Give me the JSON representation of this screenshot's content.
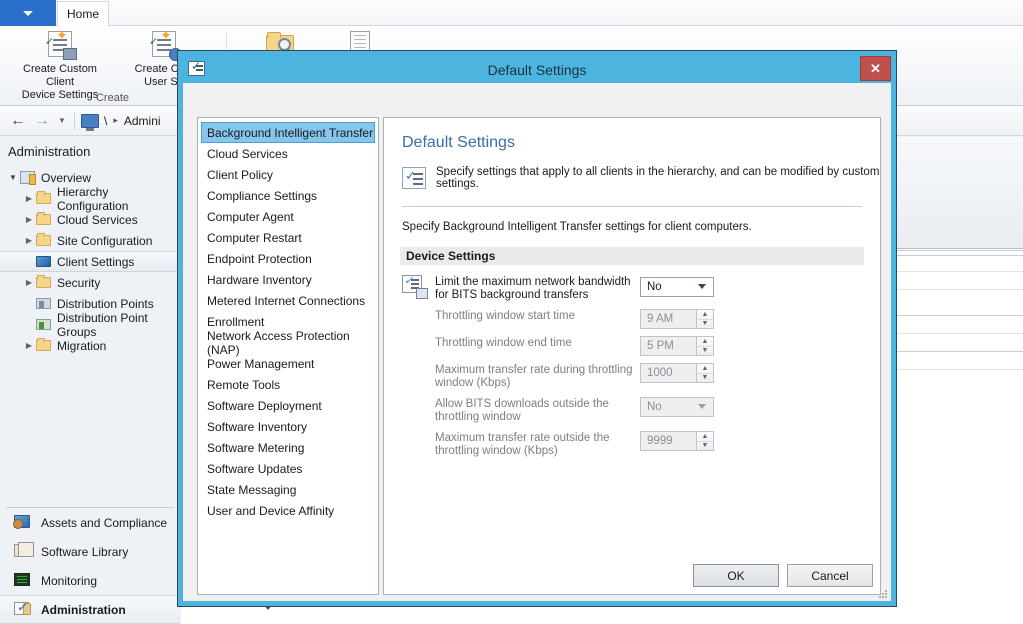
{
  "app": {
    "appmenu_icon": "chevron-down-icon",
    "tabs": [
      {
        "label": "Home"
      }
    ],
    "ribbon": {
      "items": [
        {
          "label": "Create Custom Client\nDevice Settings",
          "icon": "create-custom-client-device-settings-icon"
        },
        {
          "label": "Create Cust\nUser Se",
          "icon": "create-custom-client-user-settings-icon"
        },
        {
          "label": "",
          "icon": "folder-search-icon"
        },
        {
          "label": "",
          "icon": "document-properties-icon"
        }
      ],
      "group_label": "Create"
    },
    "navbar": {
      "back_icon": "back-arrow-icon",
      "forward_icon": "forward-arrow-icon",
      "dropdown_icon": "chevron-down-icon",
      "root_icon": "computer-icon",
      "root_crumb": "\\",
      "separator": "▸",
      "crumb": "Admini"
    },
    "left_pane": {
      "title": "Administration",
      "tree": [
        {
          "label": "Overview",
          "icon": "overview-icon",
          "indent": 0,
          "expander": "expanded",
          "selected": false
        },
        {
          "label": "Hierarchy Configuration",
          "icon": "folder-icon",
          "indent": 1,
          "expander": "collapsed",
          "selected": false
        },
        {
          "label": "Cloud Services",
          "icon": "folder-icon",
          "indent": 1,
          "expander": "collapsed",
          "selected": false
        },
        {
          "label": "Site Configuration",
          "icon": "folder-icon",
          "indent": 1,
          "expander": "collapsed",
          "selected": false
        },
        {
          "label": "Client Settings",
          "icon": "monitor-icon",
          "indent": 1,
          "expander": "none",
          "selected": true
        },
        {
          "label": "Security",
          "icon": "folder-icon",
          "indent": 1,
          "expander": "collapsed",
          "selected": false
        },
        {
          "label": "Distribution Points",
          "icon": "distribution-point-icon",
          "indent": 1,
          "expander": "none",
          "selected": false
        },
        {
          "label": "Distribution Point Groups",
          "icon": "distribution-point-group-icon",
          "indent": 1,
          "expander": "none",
          "selected": false
        },
        {
          "label": "Migration",
          "icon": "folder-icon",
          "indent": 1,
          "expander": "collapsed",
          "selected": false
        }
      ],
      "nav_buttons": [
        {
          "label": "Assets and Compliance",
          "icon": "assets-and-compliance-icon",
          "active": false
        },
        {
          "label": "Software Library",
          "icon": "software-library-icon",
          "active": false
        },
        {
          "label": "Monitoring",
          "icon": "monitoring-icon",
          "active": false
        },
        {
          "label": "Administration",
          "icon": "administration-icon",
          "active": true
        }
      ]
    }
  },
  "dialog": {
    "title": "Default Settings",
    "title_icon": "client-settings-icon",
    "close_label": "✕",
    "list": [
      {
        "label": "Background Intelligent Transfer",
        "selected": true
      },
      {
        "label": "Cloud Services",
        "selected": false
      },
      {
        "label": "Client Policy",
        "selected": false
      },
      {
        "label": "Compliance Settings",
        "selected": false
      },
      {
        "label": "Computer Agent",
        "selected": false
      },
      {
        "label": "Computer Restart",
        "selected": false
      },
      {
        "label": "Endpoint Protection",
        "selected": false
      },
      {
        "label": "Hardware Inventory",
        "selected": false
      },
      {
        "label": "Metered Internet Connections",
        "selected": false
      },
      {
        "label": "Enrollment",
        "selected": false
      },
      {
        "label": "Network Access Protection (NAP)",
        "selected": false
      },
      {
        "label": "Power Management",
        "selected": false
      },
      {
        "label": "Remote Tools",
        "selected": false
      },
      {
        "label": "Software Deployment",
        "selected": false
      },
      {
        "label": "Software Inventory",
        "selected": false
      },
      {
        "label": "Software Metering",
        "selected": false
      },
      {
        "label": "Software Updates",
        "selected": false
      },
      {
        "label": "State Messaging",
        "selected": false
      },
      {
        "label": "User and Device Affinity",
        "selected": false
      }
    ],
    "panel": {
      "heading": "Default Settings",
      "description_icon": "client-settings-icon",
      "description": "Specify settings that apply to all clients in the hierarchy, and can be modified by custom settings.",
      "subtext": "Specify Background Intelligent Transfer settings for client computers.",
      "section_header": "Device Settings",
      "group_icon": "bits-device-settings-icon",
      "settings": [
        {
          "label": "Limit the maximum network bandwidth for BITS background transfers",
          "control": "select",
          "value": "No",
          "disabled": false
        },
        {
          "label": "Throttling window start time",
          "control": "spinner",
          "value": "9 AM",
          "disabled": true
        },
        {
          "label": "Throttling window end time",
          "control": "spinner",
          "value": "5 PM",
          "disabled": true
        },
        {
          "label": "Maximum transfer rate during throttling window (Kbps)",
          "control": "spinner",
          "value": "1000",
          "disabled": true
        },
        {
          "label": "Allow BITS downloads outside the throttling window",
          "control": "select",
          "value": "No",
          "disabled": true
        },
        {
          "label": "Maximum transfer rate outside the throttling window (Kbps)",
          "control": "spinner",
          "value": "9999",
          "disabled": true
        }
      ]
    },
    "buttons": {
      "ok": "OK",
      "cancel": "Cancel"
    }
  },
  "colors": {
    "dialog_border": "#4db4e0",
    "title_bar": "#4db4e0",
    "close_button": "#c0504d",
    "selection": "#86c5ec",
    "panel_heading": "#3a6ea5",
    "app_menu": "#2a6fc9"
  }
}
